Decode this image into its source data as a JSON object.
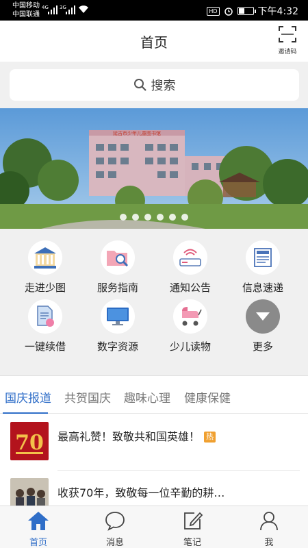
{
  "status_bar": {
    "carrier_1": "中国移动",
    "carrier_2": "中国联通",
    "net_1": "4G",
    "net_2": "3G",
    "hd": "HD",
    "time": "下午4:32",
    "icons": [
      "signal-icon",
      "wifi-icon",
      "alarm-icon",
      "battery-icon"
    ]
  },
  "header": {
    "title": "首页",
    "invite_label": "邀请码",
    "invite_icon": "scan-icon"
  },
  "search": {
    "label": "搜索",
    "icon": "search-icon"
  },
  "banner": {
    "slide_count": 6,
    "active_index": 0,
    "sign_text": "延吉市少年儿童图书馆"
  },
  "grid": {
    "items": [
      {
        "label": "走进少图",
        "icon": "library-building-icon"
      },
      {
        "label": "服务指南",
        "icon": "folder-search-icon"
      },
      {
        "label": "通知公告",
        "icon": "router-icon"
      },
      {
        "label": "信息速递",
        "icon": "newspaper-icon"
      },
      {
        "label": "一键续借",
        "icon": "document-renew-icon"
      },
      {
        "label": "数字资源",
        "icon": "monitor-icon"
      },
      {
        "label": "少儿读物",
        "icon": "stroller-icon"
      },
      {
        "label": "更多",
        "icon": "chevron-down-icon"
      }
    ]
  },
  "tabs": {
    "items": [
      "国庆报道",
      "共贺国庆",
      "趣味心理",
      "健康保健"
    ],
    "active_index": 0
  },
  "news": {
    "items": [
      {
        "title": "最高礼赞！致敬共和国英雄！",
        "badge": "热"
      },
      {
        "title": "收获70年，致敬每一位辛勤的耕…",
        "badge": ""
      }
    ]
  },
  "bottom_nav": {
    "items": [
      {
        "label": "首页",
        "icon": "home-icon"
      },
      {
        "label": "消息",
        "icon": "chat-bubble-icon"
      },
      {
        "label": "笔记",
        "icon": "edit-note-icon"
      },
      {
        "label": "我",
        "icon": "user-icon"
      }
    ],
    "active_index": 0
  },
  "colors": {
    "accent": "#2f6ec8",
    "hot_badge": "#f0a030",
    "background": "#f0f0f0"
  }
}
